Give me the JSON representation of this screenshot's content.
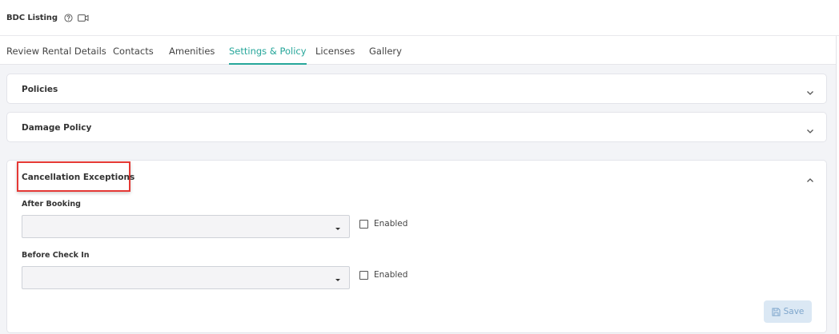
{
  "header": {
    "title": "BDC Listing",
    "help_icon": "help-circle-icon",
    "video_icon": "video-camera-icon"
  },
  "tabs": [
    {
      "label": "Review Rental Details",
      "active": false
    },
    {
      "label": "Contacts",
      "active": false
    },
    {
      "label": "Amenities",
      "active": false
    },
    {
      "label": "Settings & Policy",
      "active": true
    },
    {
      "label": "Licenses",
      "active": false
    },
    {
      "label": "Gallery",
      "active": false
    }
  ],
  "panels": {
    "policies": {
      "title": "Policies",
      "state": "collapsed"
    },
    "damage_policy": {
      "title": "Damage Policy",
      "state": "collapsed"
    },
    "cancellation_exceptions": {
      "title": "Cancellation Exceptions",
      "state": "expanded",
      "fields": [
        {
          "label": "After Booking",
          "value": "",
          "checkbox_label": "Enabled",
          "checked": false
        },
        {
          "label": "Before Check In",
          "value": "",
          "checkbox_label": "Enabled",
          "checked": false
        }
      ],
      "save_label": "Save"
    }
  },
  "colors": {
    "accent": "#26a69a",
    "highlight": "#e53935",
    "save_bg": "#dbe8f4",
    "save_text": "#7ea6cc"
  }
}
